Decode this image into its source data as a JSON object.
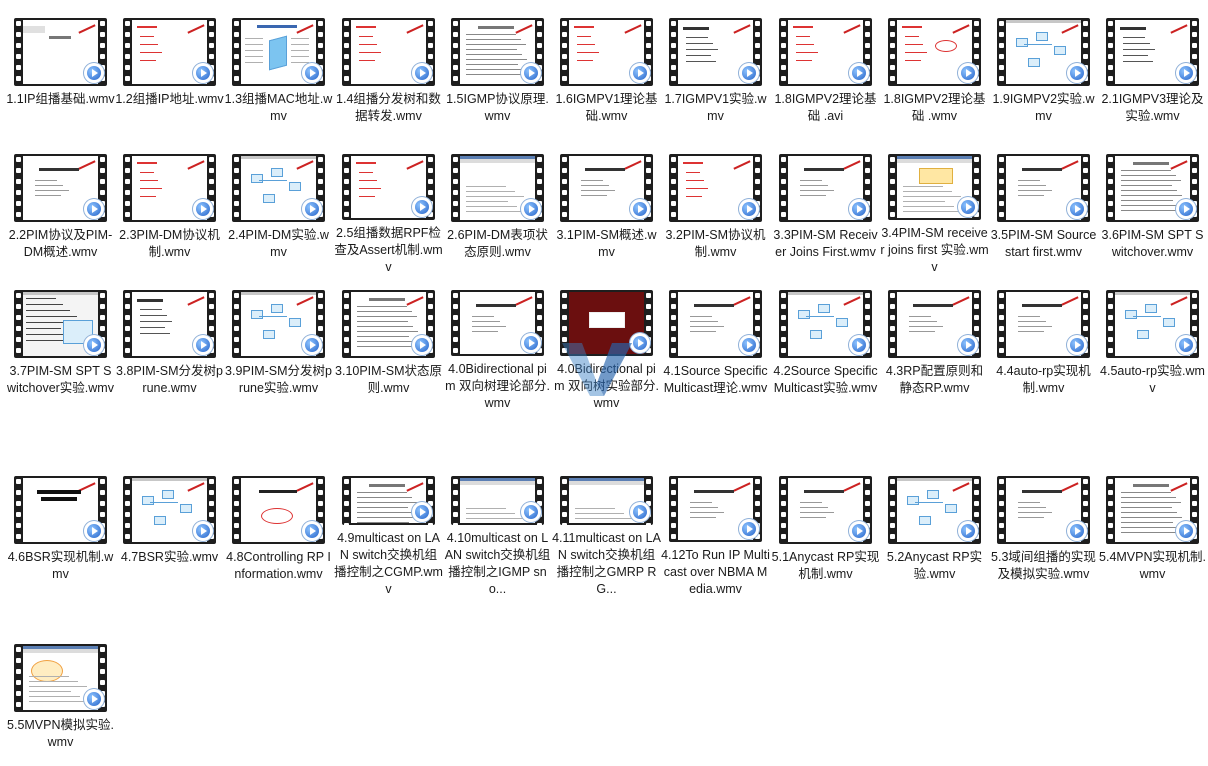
{
  "files": [
    {
      "name": "1.1IP组播基础.wmv",
      "icon": "video-file-icon"
    },
    {
      "name": "1.2组播IP地址.wmv",
      "icon": "video-file-icon"
    },
    {
      "name": "1.3组播MAC地址.wmv",
      "icon": "video-file-icon"
    },
    {
      "name": "1.4组播分发树和数据转发.wmv",
      "icon": "video-file-icon"
    },
    {
      "name": "1.5IGMP协议原理.wmv",
      "icon": "video-file-icon"
    },
    {
      "name": "1.6IGMPV1理论基础.wmv",
      "icon": "video-file-icon"
    },
    {
      "name": "1.7IGMPV1实验.wmv",
      "icon": "video-file-icon"
    },
    {
      "name": "1.8IGMPV2理论基础 .avi",
      "icon": "video-file-icon"
    },
    {
      "name": "1.8IGMPV2理论基础 .wmv",
      "icon": "video-file-icon"
    },
    {
      "name": "1.9IGMPV2实验.wmv",
      "icon": "video-file-icon"
    },
    {
      "name": "2.1IGMPV3理论及实验.wmv",
      "icon": "video-file-icon"
    },
    {
      "name": "2.2PIM协议及PIM-DM概述.wmv",
      "icon": "video-file-icon"
    },
    {
      "name": "2.3PIM-DM协议机制.wmv",
      "icon": "video-file-icon"
    },
    {
      "name": "2.4PIM-DM实验.wmv",
      "icon": "video-file-icon"
    },
    {
      "name": "2.5组播数据RPF检查及Assert机制.wmv",
      "icon": "video-file-icon"
    },
    {
      "name": "2.6PIM-DM表项状态原则.wmv",
      "icon": "video-file-icon"
    },
    {
      "name": "3.1PIM-SM概述.wmv",
      "icon": "video-file-icon"
    },
    {
      "name": "3.2PIM-SM协议机制.wmv",
      "icon": "video-file-icon"
    },
    {
      "name": "3.3PIM-SM Receiver Joins First.wmv",
      "icon": "video-file-icon"
    },
    {
      "name": "3.4PIM-SM receiver joins first 实验.wmv",
      "icon": "video-file-icon"
    },
    {
      "name": "3.5PIM-SM Source start first.wmv",
      "icon": "video-file-icon"
    },
    {
      "name": "3.6PIM-SM SPT Switchover.wmv",
      "icon": "video-file-icon"
    },
    {
      "name": "3.7PIM-SM SPT Switchover实验.wmv",
      "icon": "video-file-icon"
    },
    {
      "name": "3.8PIM-SM分发树prune.wmv",
      "icon": "video-file-icon"
    },
    {
      "name": "3.9PIM-SM分发树prune实验.wmv",
      "icon": "video-file-icon"
    },
    {
      "name": "3.10PIM-SM状态原则.wmv",
      "icon": "video-file-icon"
    },
    {
      "name": "4.0Bidirectional pim 双向树理论部分.wmv",
      "icon": "video-file-icon"
    },
    {
      "name": "4.0Bidirectional pim 双向树实验部分.wmv",
      "icon": "video-file-icon"
    },
    {
      "name": "4.1Source Specific Multicast理论.wmv",
      "icon": "video-file-icon"
    },
    {
      "name": "4.2Source Specific Multicast实验.wmv",
      "icon": "video-file-icon"
    },
    {
      "name": "4.3RP配置原则和静态RP.wmv",
      "icon": "video-file-icon"
    },
    {
      "name": "4.4auto-rp实现机制.wmv",
      "icon": "video-file-icon"
    },
    {
      "name": "4.5auto-rp实验.wmv",
      "icon": "video-file-icon"
    },
    {
      "name": "4.6BSR实现机制.wmv",
      "icon": "video-file-icon"
    },
    {
      "name": "4.7BSR实验.wmv",
      "icon": "video-file-icon"
    },
    {
      "name": "4.8Controlling RP Information.wmv",
      "icon": "video-file-icon"
    },
    {
      "name": "4.9multicast on LAN switch交换机组播控制之CGMP.wmv",
      "icon": "video-file-icon"
    },
    {
      "name": "4.10multicast on LAN switch交换机组播控制之IGMP sno...",
      "icon": "video-file-icon"
    },
    {
      "name": "4.11multicast on LAN switch交换机组播控制之GMRP RG...",
      "icon": "video-file-icon"
    },
    {
      "name": "4.12To Run IP Multicast over NBMA Media.wmv",
      "icon": "video-file-icon"
    },
    {
      "name": "5.1Anycast RP实现机制.wmv",
      "icon": "video-file-icon"
    },
    {
      "name": "5.2Anycast RP实验.wmv",
      "icon": "video-file-icon"
    },
    {
      "name": "5.3域间组播的实现及模拟实验.wmv",
      "icon": "video-file-icon"
    },
    {
      "name": "5.4MVPN实现机制.wmv",
      "icon": "video-file-icon"
    },
    {
      "name": "5.5MVPN模拟实验.wmv",
      "icon": "video-file-icon"
    }
  ],
  "thumb_styles": [
    "slide",
    "slide-red",
    "diagram",
    "slide-red",
    "doc",
    "slide-red",
    "slide-lines",
    "slide-red",
    "slide-red-ink",
    "topo",
    "slide-lines",
    "slide-center",
    "slide-red",
    "topo",
    "slide-red",
    "window",
    "slide-center",
    "slide-red",
    "slide-center",
    "window-yellow",
    "slide-center",
    "doc",
    "terminal",
    "slide-lines",
    "topo",
    "doc",
    "slide-center",
    "desktop-red",
    "slide-center",
    "topo",
    "slide-center",
    "slide-center",
    "topo",
    "slide-bold",
    "topo",
    "slide-circle",
    "doc",
    "window",
    "window",
    "slide-center",
    "slide-center",
    "topo",
    "slide-center",
    "doc",
    "window-topo"
  ]
}
